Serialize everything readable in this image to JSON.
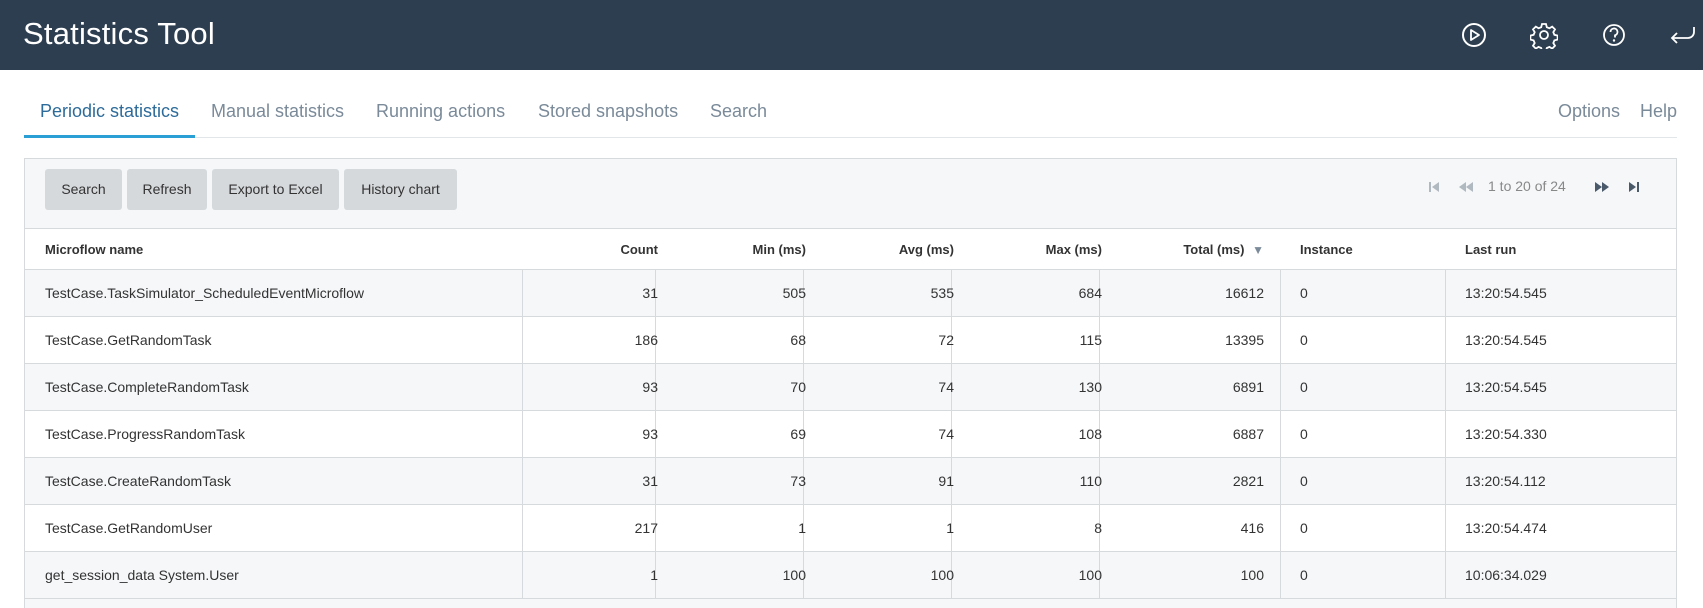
{
  "header": {
    "title": "Statistics Tool",
    "icons": [
      "play-circle-icon",
      "gear-icon",
      "help-circle-icon",
      "return-arrow-icon"
    ]
  },
  "tabs": {
    "left": [
      "Periodic statistics",
      "Manual statistics",
      "Running actions",
      "Stored snapshots",
      "Search"
    ],
    "right": [
      "Options",
      "Help"
    ],
    "active": "Periodic statistics"
  },
  "toolbar": {
    "search": "Search",
    "refresh": "Refresh",
    "export": "Export to Excel",
    "history": "History chart"
  },
  "pager": {
    "text": "1 to 20 of 24"
  },
  "table": {
    "columns": [
      "Microflow name",
      "Count",
      "Min (ms)",
      "Avg (ms)",
      "Max (ms)",
      "Total (ms)",
      "Instance",
      "Last run"
    ],
    "sorted_column": "Total (ms)",
    "sort_direction": "descending",
    "rows": [
      [
        "TestCase.TaskSimulator_ScheduledEventMicroflow",
        "31",
        "505",
        "535",
        "684",
        "16612",
        "0",
        "13:20:54.545"
      ],
      [
        "TestCase.GetRandomTask",
        "186",
        "68",
        "72",
        "115",
        "13395",
        "0",
        "13:20:54.545"
      ],
      [
        "TestCase.CompleteRandomTask",
        "93",
        "70",
        "74",
        "130",
        "6891",
        "0",
        "13:20:54.545"
      ],
      [
        "TestCase.ProgressRandomTask",
        "93",
        "69",
        "74",
        "108",
        "6887",
        "0",
        "13:20:54.330"
      ],
      [
        "TestCase.CreateRandomTask",
        "31",
        "73",
        "91",
        "110",
        "2821",
        "0",
        "13:20:54.112"
      ],
      [
        "TestCase.GetRandomUser",
        "217",
        "1",
        "1",
        "8",
        "416",
        "0",
        "13:20:54.474"
      ],
      [
        "get_session_data System.User",
        "1",
        "100",
        "100",
        "100",
        "100",
        "0",
        "10:06:34.029"
      ]
    ]
  },
  "colors": {
    "header_bg": "#2d3e50",
    "active_tab": "#2d6b9a",
    "tab_underline": "#2a9fd6",
    "button_bg": "#d6d9dc"
  }
}
